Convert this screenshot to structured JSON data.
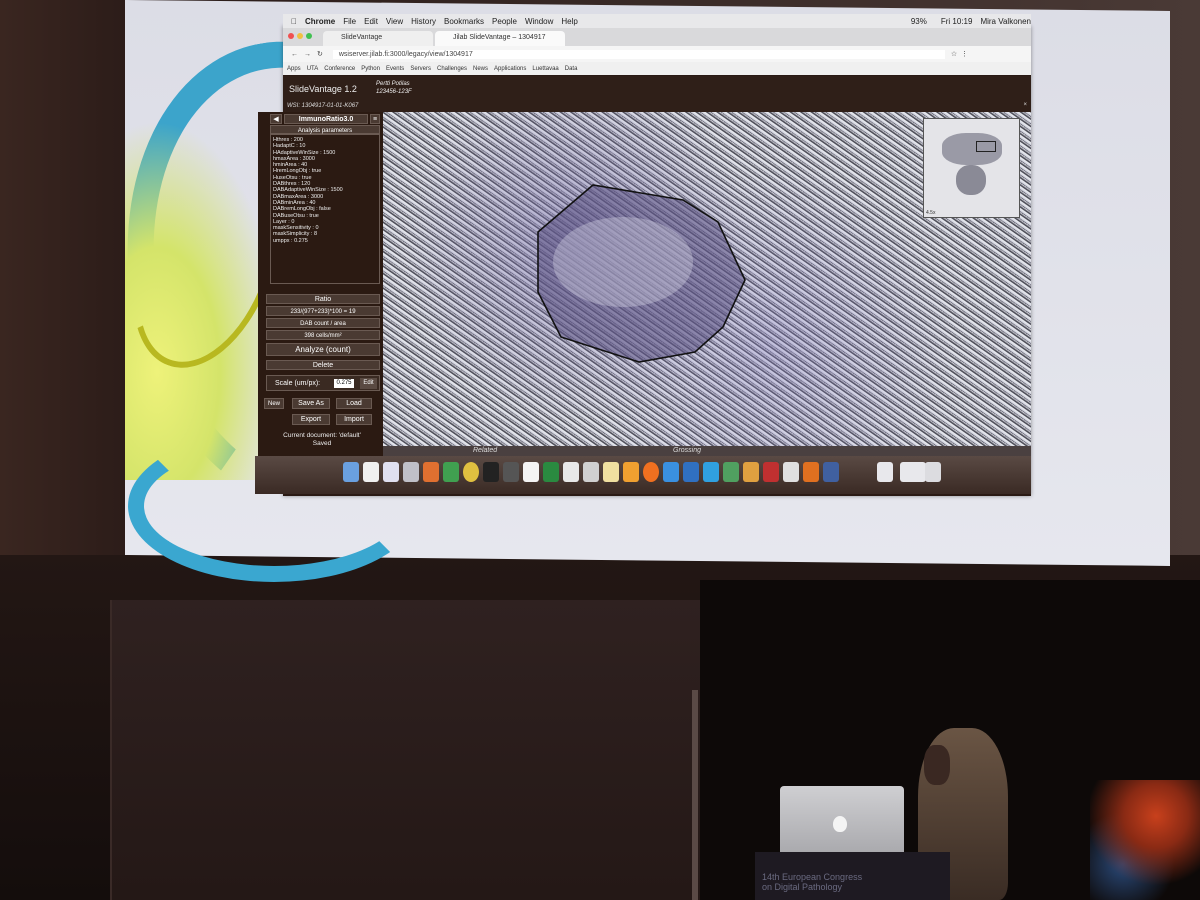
{
  "menubar": {
    "app": "Chrome",
    "items": [
      "File",
      "Edit",
      "View",
      "History",
      "Bookmarks",
      "People",
      "Window",
      "Help"
    ],
    "battery": "93%",
    "clock": "Fri 10:19",
    "user": "Mira Valkonen"
  },
  "tabs": [
    {
      "label": "SlideVantage"
    },
    {
      "label": "Jilab SlideVantage – 1304917"
    }
  ],
  "address": {
    "url": "wsiserver.jilab.fi:3000/legacy/view/1304917"
  },
  "bookmarks": [
    "Apps",
    "UTA",
    "Conference",
    "Python",
    "Events",
    "Servers",
    "Challenges",
    "News",
    "Applications",
    "Luettavaa",
    "Data"
  ],
  "app": {
    "title": "SlideVantage 1.2",
    "patient_name": "Pertti Potilas",
    "patient_id": "123456-123F",
    "wsi": "WSI: 1304917-01-01-K067"
  },
  "panel": {
    "plugin": "ImmunoRatio3.0",
    "params_header": "Analysis parameters",
    "params": [
      "Hthres : 200",
      "HadaptC : 10",
      "HAdaptiveWinSize : 1500",
      "hmaxArea : 3000",
      "hminArea : 40",
      "HremLongObj : true",
      "HuseOtsu : true",
      "DABthres : 120",
      "DABAdaptiveWinSize : 1500",
      "DABmaxArea : 3000",
      "DABminArea : 40",
      "DABremLongObj : false",
      "DABuseOtsu : true",
      "Layer : 0",
      "maskSensitivity : 0",
      "maskSimplicity : 8",
      "umppx : 0.275"
    ],
    "ratio_label": "Ratio",
    "ratio_value": "233/(977+233)*100 = 19",
    "dab_label": "DAB count / area",
    "dab_value": "398 cells/mm²",
    "analyze": "Analyze (count)",
    "delete": "Delete",
    "scale_label": "Scale (um/px):",
    "scale_value": "0.275",
    "edit": "Edit",
    "new": "New",
    "save_as": "Save As",
    "load": "Load",
    "export": "Export",
    "import": "Import",
    "doc_status": "Current document: 'default'",
    "saved": "Saved"
  },
  "viewer": {
    "minimap_zoom": "4.5x",
    "related": "Related",
    "grossing": "Grossing"
  },
  "podium": {
    "line1": "14th European Congress",
    "line2": "on Digital Pathology"
  },
  "colors": {
    "app_bg": "#2b1a12",
    "accent_blue": "#2b9ec8",
    "accent_yellow": "#d4e46a"
  }
}
